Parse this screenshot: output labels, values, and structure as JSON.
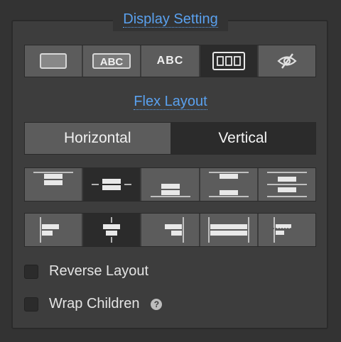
{
  "title": "Display Setting",
  "display_modes": [
    {
      "icon": "block-icon",
      "active": false
    },
    {
      "icon": "inline-block-icon",
      "label": "ABC",
      "active": false
    },
    {
      "icon": "inline-icon",
      "label": "ABC",
      "active": false
    },
    {
      "icon": "flex-icon",
      "active": true
    },
    {
      "icon": "eye-slash-icon",
      "active": false
    }
  ],
  "flex_section": {
    "title": "Flex Layout",
    "direction": {
      "horizontal_label": "Horizontal",
      "vertical_label": "Vertical",
      "selected": "Vertical"
    }
  },
  "justify_options": [
    {
      "icon": "justify-start-icon",
      "active": false
    },
    {
      "icon": "justify-center-icon",
      "active": true
    },
    {
      "icon": "justify-end-icon",
      "active": false
    },
    {
      "icon": "justify-space-between-icon",
      "active": false
    },
    {
      "icon": "justify-space-around-icon",
      "active": false
    }
  ],
  "align_options": [
    {
      "icon": "align-start-icon",
      "active": false
    },
    {
      "icon": "align-center-icon",
      "active": true
    },
    {
      "icon": "align-end-icon",
      "active": false
    },
    {
      "icon": "align-stretch-icon",
      "active": false
    },
    {
      "icon": "align-baseline-icon",
      "active": false
    }
  ],
  "options": {
    "reverse_label": "Reverse Layout",
    "reverse_checked": false,
    "wrap_label": "Wrap Children",
    "wrap_checked": false,
    "help_icon": "question-circle-icon",
    "help_glyph": "?"
  },
  "colors": {
    "accent": "#5aa1ef",
    "active_bg": "#2b2b2b",
    "button_bg": "#5c5c5c"
  }
}
